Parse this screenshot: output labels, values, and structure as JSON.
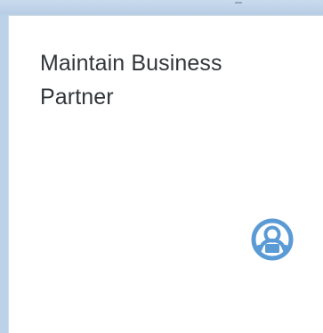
{
  "tile": {
    "title": "Maintain Business Partner",
    "icon": "business-partner-icon",
    "accent_color": "#5b9bd5"
  }
}
